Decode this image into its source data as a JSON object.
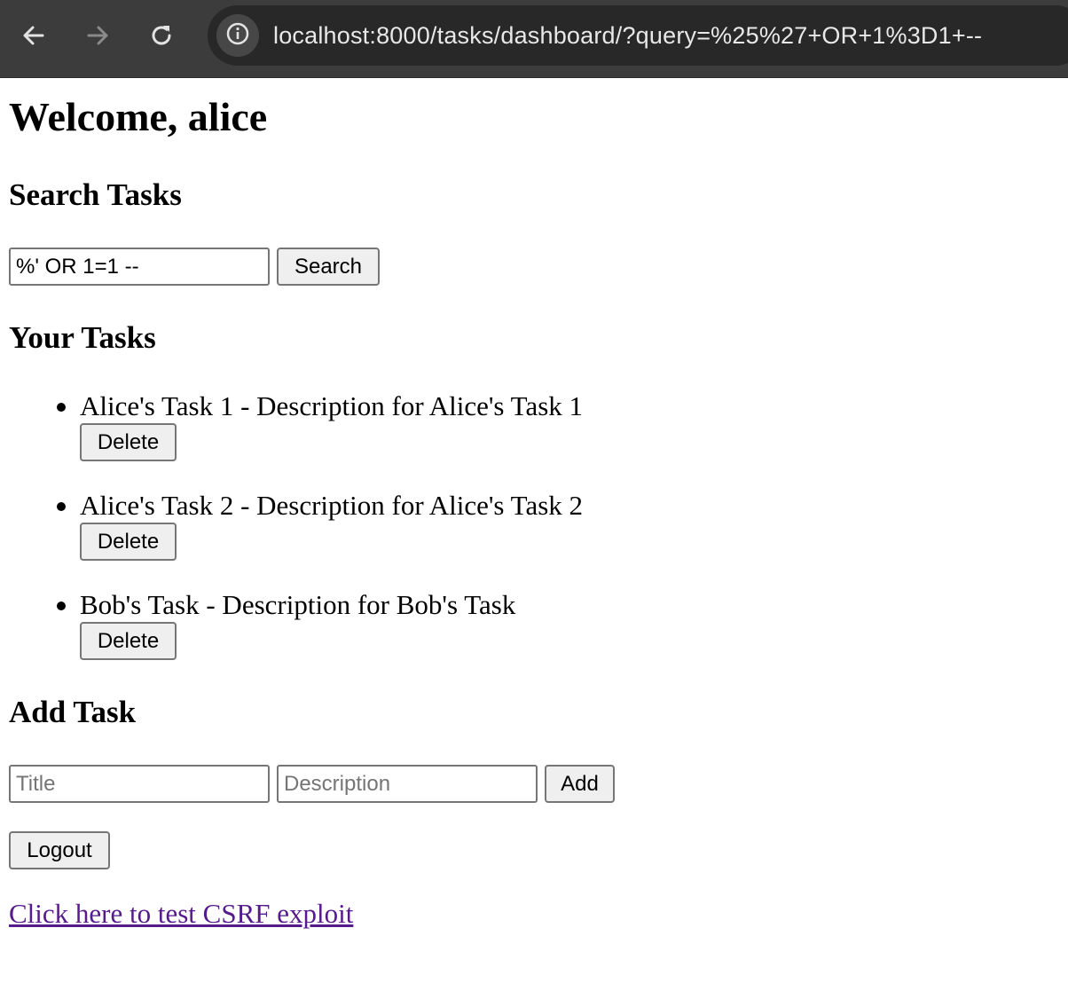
{
  "browser": {
    "url": "localhost:8000/tasks/dashboard/?query=%25%27+OR+1%3D1+--",
    "back_icon": "arrow-left-icon",
    "forward_icon": "arrow-right-icon",
    "reload_icon": "reload-icon",
    "info_icon": "info-icon"
  },
  "page": {
    "welcome": "Welcome, alice",
    "search": {
      "heading": "Search Tasks",
      "input_value": "%' OR 1=1 --",
      "button_label": "Search"
    },
    "tasks": {
      "heading": "Your Tasks",
      "items": [
        {
          "text": "Alice's Task 1 - Description for Alice's Task 1",
          "delete_label": "Delete"
        },
        {
          "text": "Alice's Task 2 - Description for Alice's Task 2",
          "delete_label": "Delete"
        },
        {
          "text": "Bob's Task - Description for Bob's Task",
          "delete_label": "Delete"
        }
      ]
    },
    "add_task": {
      "heading": "Add Task",
      "title_placeholder": "Title",
      "description_placeholder": "Description",
      "button_label": "Add"
    },
    "logout_label": "Logout",
    "csrf_link": "Click here to test CSRF exploit"
  },
  "colors": {
    "chrome_bg": "#3c3c3c",
    "omnibox_bg": "#282828",
    "link_visited": "#551a8b"
  }
}
